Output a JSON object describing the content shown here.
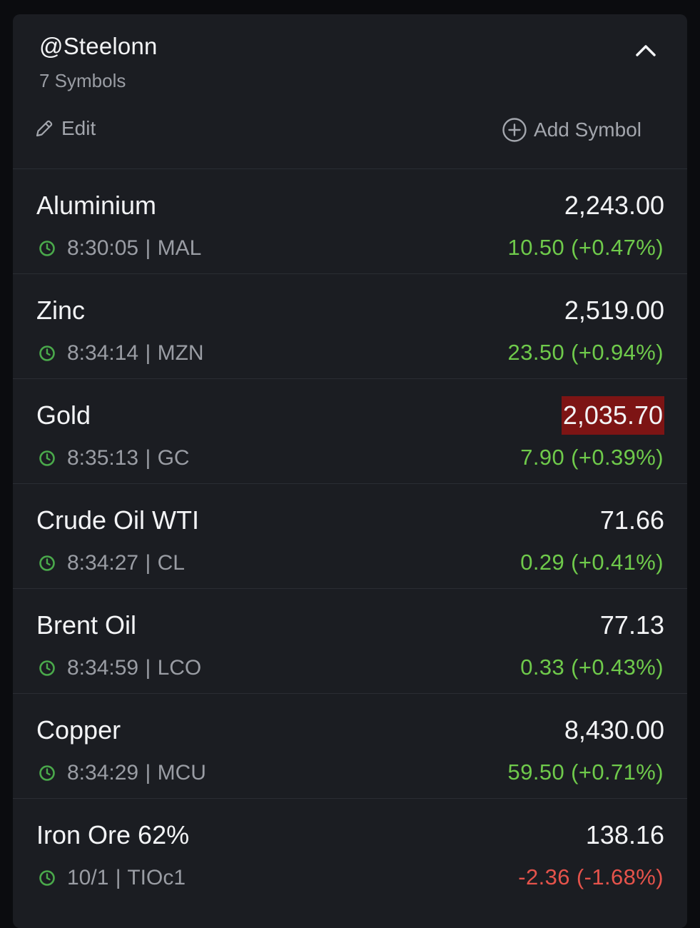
{
  "watchlist": {
    "title": "@Steelonn",
    "subtitle": "7 Symbols",
    "edit_label": "Edit",
    "add_label": "Add Symbol",
    "collapse_icon": "chevron-up-icon"
  },
  "colors": {
    "positive": "#6fca4b",
    "negative": "#e5534b",
    "flash_down": "#7d1414",
    "clock_icon": "#4aa94b"
  },
  "symbols": [
    {
      "name": "Aluminium",
      "time": "8:30:05",
      "ticker": "MAL",
      "price": "2,243.00",
      "change": "10.50",
      "change_pct": "(+0.47%)",
      "direction": "up",
      "flash": false
    },
    {
      "name": "Zinc",
      "time": "8:34:14",
      "ticker": "MZN",
      "price": "2,519.00",
      "change": "23.50",
      "change_pct": "(+0.94%)",
      "direction": "up",
      "flash": false
    },
    {
      "name": "Gold",
      "time": "8:35:13",
      "ticker": "GC",
      "price": "2,035.70",
      "change": "7.90",
      "change_pct": "(+0.39%)",
      "direction": "up",
      "flash": true
    },
    {
      "name": "Crude Oil WTI",
      "time": "8:34:27",
      "ticker": "CL",
      "price": "71.66",
      "change": "0.29",
      "change_pct": "(+0.41%)",
      "direction": "up",
      "flash": false
    },
    {
      "name": "Brent Oil",
      "time": "8:34:59",
      "ticker": "LCO",
      "price": "77.13",
      "change": "0.33",
      "change_pct": "(+0.43%)",
      "direction": "up",
      "flash": false
    },
    {
      "name": "Copper",
      "time": "8:34:29",
      "ticker": "MCU",
      "price": "8,430.00",
      "change": "59.50",
      "change_pct": "(+0.71%)",
      "direction": "up",
      "flash": false
    },
    {
      "name": "Iron Ore 62%",
      "time": "10/1",
      "ticker": "TIOc1",
      "price": "138.16",
      "change": "-2.36",
      "change_pct": "(-1.68%)",
      "direction": "down",
      "flash": false
    }
  ]
}
